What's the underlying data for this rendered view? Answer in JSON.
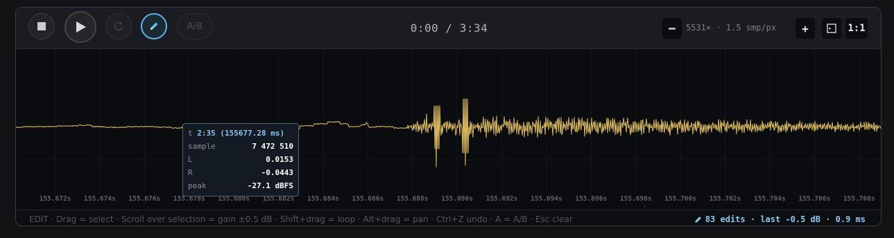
{
  "toolbar": {
    "time_display": "0:00 / 3:34",
    "ab_label": "A/B",
    "zoom_minus": "−",
    "zoom_plus": "+",
    "zoom_info": "5531× · 1.5 smp/px",
    "zoom_one_to_one": "1:1"
  },
  "icons": [
    "stop-icon",
    "play-icon",
    "loop-icon",
    "pencil-icon",
    "fit-icon",
    "pencil-icon"
  ],
  "colors": {
    "waveform": "#d4b560",
    "accent": "#5fb3e6",
    "background": "#0b0c0f"
  },
  "ruler": {
    "labels": [
      "155.672s",
      "155.674s",
      "155.676s",
      "155.678s",
      "155.680s",
      "155.682s",
      "155.684s",
      "155.686s",
      "155.688s",
      "155.690s",
      "155.692s",
      "155.694s",
      "155.696s",
      "155.698s",
      "155.700s",
      "155.702s",
      "155.704s",
      "155.706s",
      "155.708s"
    ]
  },
  "tooltip": {
    "time_key": "t",
    "time_value": "2:35 (155677.28 ms)",
    "sample_key": "sample",
    "sample_value": "7 472 510",
    "l_key": "L",
    "l_value": "0.0153",
    "r_key": "R",
    "r_value": "-0.0443",
    "peak_key": "peak",
    "peak_value": "-27.1 dBFS"
  },
  "status": {
    "hint": "EDIT · Drag = select · Scroll over selection = gain ±0.5 dB · Shift+drag = loop · Alt+drag = pan · Ctrl+Z undo · A = A/B · Esc clear",
    "edits": "83 edits · last -0.5 dB · 0.9 ms"
  }
}
